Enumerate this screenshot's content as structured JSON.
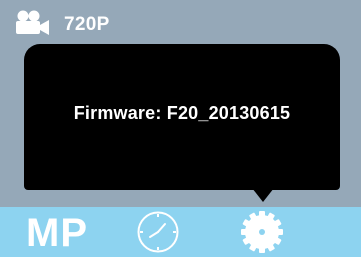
{
  "status_bar": {
    "icon": "video-camera-icon",
    "resolution": "720P"
  },
  "popup": {
    "firmware_text": "Firmware: F20_20130615"
  },
  "bottom_bar": {
    "mode_label": "MP",
    "clock_icon": "clock-icon",
    "settings_icon": "gear-icon",
    "selected": "settings"
  },
  "colors": {
    "background": "#95a8b8",
    "popup": "#000000",
    "bottom_bar": "#8dd3f0",
    "text": "#ffffff"
  }
}
